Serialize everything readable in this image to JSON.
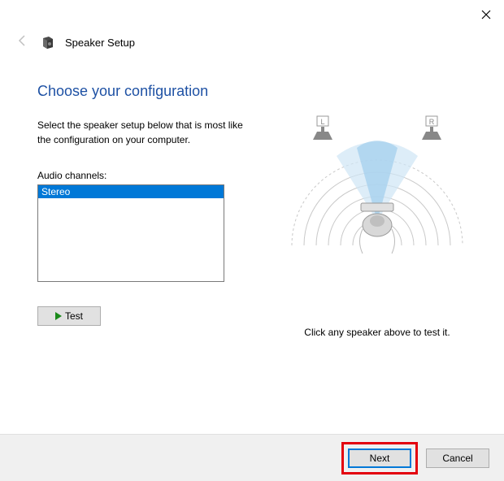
{
  "window": {
    "title": "Speaker Setup"
  },
  "page": {
    "heading": "Choose your configuration",
    "subtext": "Select the speaker setup below that is most like the configuration on your computer.",
    "channels_label": "Audio channels:",
    "channels": [
      "Stereo"
    ],
    "test_label": "Test",
    "hint": "Click any speaker above to test it."
  },
  "diagram": {
    "left_label": "L",
    "right_label": "R"
  },
  "footer": {
    "next": "Next",
    "cancel": "Cancel"
  }
}
